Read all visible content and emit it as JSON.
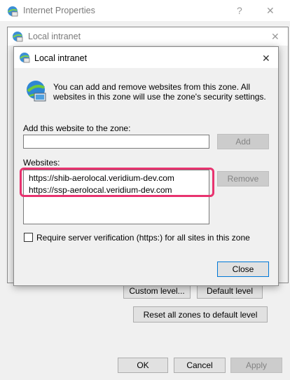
{
  "bg_window": {
    "title": "Internet Properties",
    "help_glyph": "?",
    "close_glyph": "✕",
    "buttons": {
      "custom_level": "Custom level...",
      "default_level": "Default level",
      "reset_all": "Reset all zones to default level",
      "ok": "OK",
      "cancel": "Cancel",
      "apply": "Apply"
    }
  },
  "mid_window": {
    "title": "Local intranet",
    "close_glyph": "✕"
  },
  "dialog": {
    "title": "Local intranet",
    "close_glyph": "✕",
    "description": "You can add and remove websites from this zone. All websites in this zone will use the zone's security settings.",
    "add_label": "Add this website to the zone:",
    "add_input_value": "",
    "add_button": "Add",
    "websites_label": "Websites:",
    "websites": [
      "https://shib-aerolocal.veridium-dev.com",
      "https://ssp-aerolocal.veridium-dev.com"
    ],
    "remove_button": "Remove",
    "require_https_label": "Require server verification (https:) for all sites in this zone",
    "require_https_checked": false,
    "close_button": "Close"
  },
  "colors": {
    "highlight": "#e8336f",
    "window_bg": "#f0f0f0"
  }
}
